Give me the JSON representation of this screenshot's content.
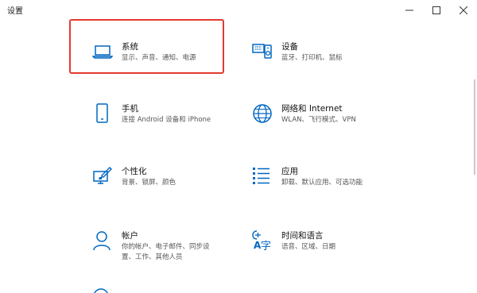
{
  "window": {
    "title": "设置"
  },
  "colors": {
    "accent": "#0067c0",
    "highlight": "#e23a2e"
  },
  "tiles": [
    {
      "id": "system",
      "icon": "laptop-icon",
      "title": "系统",
      "desc_lines": [
        "显示、声音、通知、电源"
      ]
    },
    {
      "id": "devices",
      "icon": "keyboard-speaker-icon",
      "title": "设备",
      "desc_lines": [
        "蓝牙、打印机、鼠标"
      ]
    },
    {
      "id": "phone",
      "icon": "phone-icon",
      "title": "手机",
      "desc_lines": [
        "连接 Android 设备和 iPhone"
      ]
    },
    {
      "id": "network",
      "icon": "globe-icon",
      "title": "网络和 Internet",
      "desc_lines": [
        "WLAN、飞行模式、VPN"
      ]
    },
    {
      "id": "personal",
      "icon": "paint-brush-icon",
      "title": "个性化",
      "desc_lines": [
        "背景、锁屏、颜色"
      ]
    },
    {
      "id": "apps",
      "icon": "apps-list-icon",
      "title": "应用",
      "desc_lines": [
        "卸载、默认应用、可选功能"
      ]
    },
    {
      "id": "accounts",
      "icon": "person-icon",
      "title": "帐户",
      "desc_lines": [
        "你的帐户、电子邮件、同步设",
        "置、工作、其他人员"
      ]
    },
    {
      "id": "time",
      "icon": "time-language-icon",
      "title": "时间和语言",
      "desc_lines": [
        "语音、区域、日期"
      ]
    }
  ]
}
